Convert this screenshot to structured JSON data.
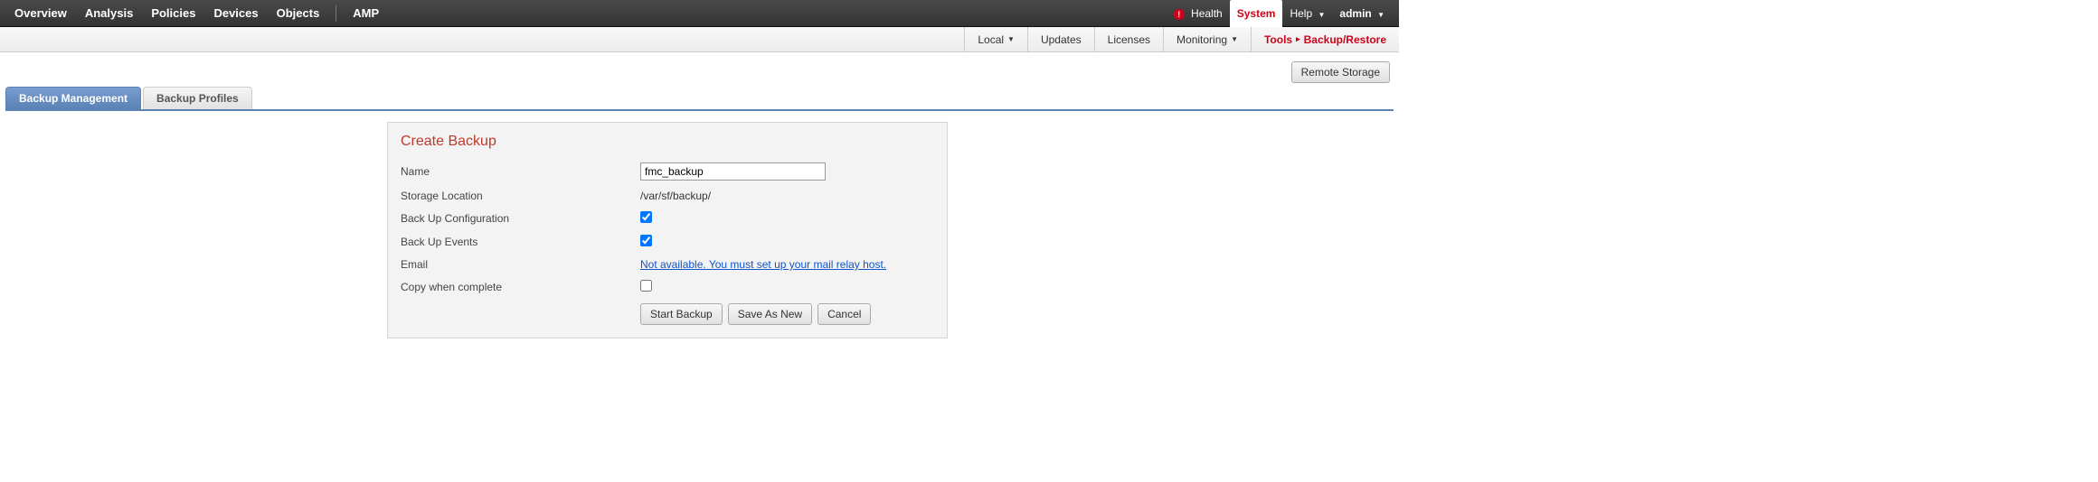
{
  "topnav": {
    "left": [
      "Overview",
      "Analysis",
      "Policies",
      "Devices",
      "Objects"
    ],
    "left_extra": "AMP",
    "health": "Health",
    "system": "System",
    "help": "Help",
    "user": "admin"
  },
  "subnav": {
    "items": [
      "Local",
      "Updates",
      "Licenses",
      "Monitoring"
    ],
    "dropdown": {
      "0": true,
      "3": true
    },
    "tools_label": "Tools",
    "active": "Backup/Restore"
  },
  "page_actions": {
    "remote_storage": "Remote Storage"
  },
  "tabs": {
    "items": [
      "Backup Management",
      "Backup Profiles"
    ],
    "active_index": 0
  },
  "form": {
    "title": "Create Backup",
    "name_label": "Name",
    "name_value": "fmc_backup",
    "storage_label": "Storage Location",
    "storage_value": "/var/sf/backup/",
    "config_label": "Back Up Configuration",
    "events_label": "Back Up Events",
    "email_label": "Email",
    "email_link": "Not available. You must set up your mail relay host.",
    "copy_label": "Copy when complete",
    "actions": {
      "start": "Start Backup",
      "save": "Save As New",
      "cancel": "Cancel"
    }
  }
}
